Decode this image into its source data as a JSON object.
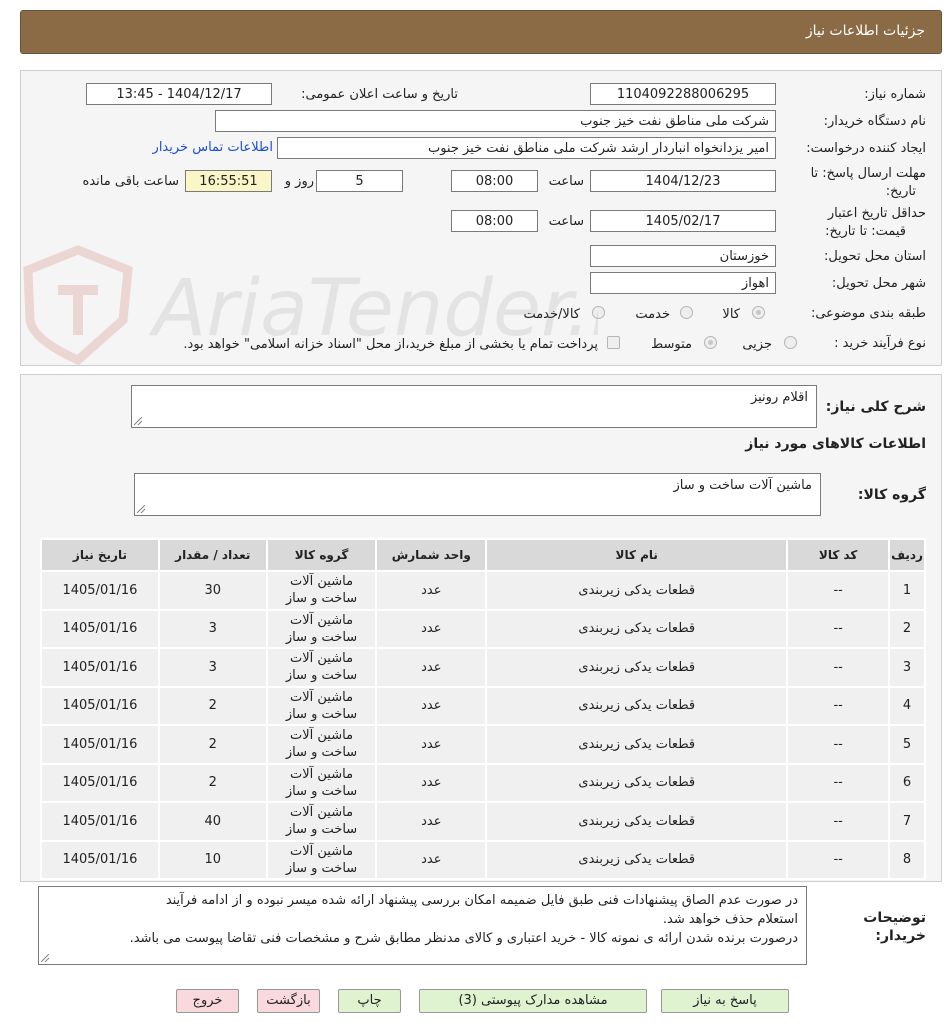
{
  "title": "جزئیات اطلاعات نیاز",
  "form": {
    "need_number_label": "شماره نیاز:",
    "need_number": "1104092288006295",
    "announce_label": "تاریخ و ساعت اعلان عمومی:",
    "announce_value": "1404/12/17 - 13:45",
    "buyer_org_label": "نام دستگاه خریدار:",
    "buyer_org": "شرکت ملی مناطق نفت خیز جنوب",
    "requester_label": "ایجاد کننده درخواست:",
    "requester": "امیر یزدانخواه انباردار ارشد شرکت ملی مناطق نفت خیز جنوب",
    "contact_link": "اطلاعات تماس خریدار",
    "deadline_label_1": "مهلت ارسال پاسخ: تا",
    "deadline_label_2": "تاریخ:",
    "deadline_date": "1404/12/23",
    "hour_label": "ساعت",
    "deadline_hour": "08:00",
    "days_value": "5",
    "days_label": "روز و",
    "remaining_time": "16:55:51",
    "remaining_label": "ساعت باقی مانده",
    "validity_label_1": "حداقل تاریخ اعتبار",
    "validity_label_2": "قیمت: تا تاریخ:",
    "validity_date": "1405/02/17",
    "validity_hour": "08:00",
    "province_label": "استان محل تحویل:",
    "province": "خوزستان",
    "city_label": "شهر محل تحویل:",
    "city": "اهواز",
    "category_label": "طبقه بندی موضوعی:",
    "category_options": [
      "کالا",
      "خدمت",
      "کالا/خدمت"
    ],
    "process_label": "نوع فرآیند خرید :",
    "process_options": [
      "جزیی",
      "متوسط"
    ],
    "payment_note": "پرداخت تمام یا بخشی از مبلغ خرید،از محل \"اسناد خزانه اسلامی\" خواهد بود."
  },
  "description": {
    "label": "شرح کلی نیاز:",
    "value": "اقلام رونیز",
    "items_title": "اطلاعات کالاهای مورد نیاز",
    "group_label": "گروه کالا:",
    "group_value": "ماشین آلات ساخت و ساز"
  },
  "table": {
    "headers": [
      "ردیف",
      "کد کالا",
      "نام کالا",
      "واحد شمارش",
      "گروه کالا",
      "تعداد / مقدار",
      "تاریخ نیاز"
    ],
    "rows": [
      {
        "row": "1",
        "code": "--",
        "name": "قطعات یدکی زیربندی",
        "unit": "عدد",
        "group1": "ماشین آلات",
        "group2": "ساخت و ساز",
        "qty": "30",
        "date": "1405/01/16"
      },
      {
        "row": "2",
        "code": "--",
        "name": "قطعات یدکی زیربندی",
        "unit": "عدد",
        "group1": "ماشین آلات",
        "group2": "ساخت و ساز",
        "qty": "3",
        "date": "1405/01/16"
      },
      {
        "row": "3",
        "code": "--",
        "name": "قطعات یدکی زیربندی",
        "unit": "عدد",
        "group1": "ماشین آلات",
        "group2": "ساخت و ساز",
        "qty": "3",
        "date": "1405/01/16"
      },
      {
        "row": "4",
        "code": "--",
        "name": "قطعات یدکی زیربندی",
        "unit": "عدد",
        "group1": "ماشین آلات",
        "group2": "ساخت و ساز",
        "qty": "2",
        "date": "1405/01/16"
      },
      {
        "row": "5",
        "code": "--",
        "name": "قطعات یدکی زیربندی",
        "unit": "عدد",
        "group1": "ماشین آلات",
        "group2": "ساخت و ساز",
        "qty": "2",
        "date": "1405/01/16"
      },
      {
        "row": "6",
        "code": "--",
        "name": "قطعات یدکی زیربندی",
        "unit": "عدد",
        "group1": "ماشین آلات",
        "group2": "ساخت و ساز",
        "qty": "2",
        "date": "1405/01/16"
      },
      {
        "row": "7",
        "code": "--",
        "name": "قطعات یدکی زیربندی",
        "unit": "عدد",
        "group1": "ماشین آلات",
        "group2": "ساخت و ساز",
        "qty": "40",
        "date": "1405/01/16"
      },
      {
        "row": "8",
        "code": "--",
        "name": "قطعات یدکی زیربندی",
        "unit": "عدد",
        "group1": "ماشین آلات",
        "group2": "ساخت و ساز",
        "qty": "10",
        "date": "1405/01/16"
      }
    ]
  },
  "notes": {
    "label_1": "توضیحات",
    "label_2": "خریدار:",
    "line1": "در صورت عدم الصاق پیشنهادات فنی طبق فایل ضمیمه امکان بررسی پیشنهاد ارائه شده میسر نبوده و از ادامه فرآیند",
    "line2": "استعلام حذف خواهد شد.",
    "line3": "درصورت برنده شدن ارائه ی نمونه کالا - خرید اعتباری و کالای مدنظر مطابق شرح و مشخصات فنی تقاضا پیوست می باشد."
  },
  "buttons": {
    "reply": "پاسخ به نیاز",
    "attachments": "مشاهده مدارک پیوستی (3)",
    "print": "چاپ",
    "back": "بازگشت",
    "exit": "خروج"
  },
  "watermark": "AriaTender.net",
  "colors": {
    "title_bar": "#8b6b45",
    "link": "#1a4fd6",
    "green_button": "#dff3d0",
    "pink_button": "#f9d9de"
  }
}
